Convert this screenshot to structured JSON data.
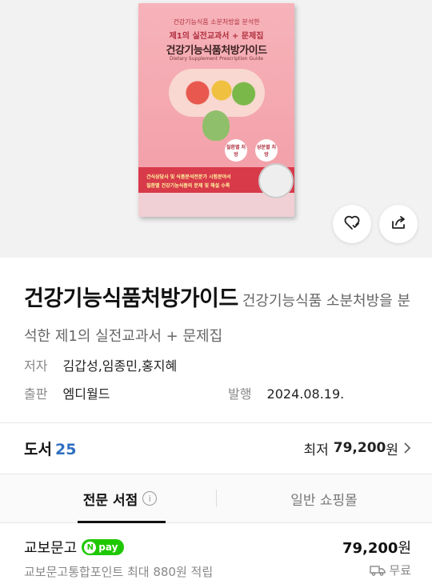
{
  "cover": {
    "line1": "건강기능식품 소분처방을 분석한",
    "line2": "제1의 실전교과서 + 문제집",
    "title": "건강기능식품처방가이드",
    "english": "Dietary Supplement Prescription Guide",
    "badge1": "질환별 처방",
    "badge2": "성분별 처방",
    "band1": "건식상담사 및 식품분석전문가 시험분야서",
    "band2": "질환별 건강기능식품의 문제 및 해설 수록"
  },
  "actions": {
    "wishlist_icon": "heart-check-icon",
    "share_icon": "share-icon"
  },
  "product": {
    "title": "건강기능식품처방가이드",
    "subtitle": "건강기능식품 소분처방을 분석한 제1의 실전교과서 + 문제집",
    "author_label": "저자",
    "author_value": "김갑성,임종민,홍지혜",
    "publisher_label": "출판",
    "publisher_value": "엠디월드",
    "date_label": "발행",
    "date_value": "2024.08.19."
  },
  "books": {
    "label": "도서",
    "count": "25",
    "lowest_label": "최저",
    "lowest_price": "79,200",
    "currency": "원"
  },
  "tabs": [
    {
      "label": "전문 서점",
      "active": true
    },
    {
      "label": "일반 쇼핑몰",
      "active": false
    }
  ],
  "store": {
    "name": "교보문고",
    "pay_badge": "pay",
    "pay_n": "N",
    "price": "79,200",
    "currency": "원",
    "points": "교보문고통합포인트 최대 880원 적립",
    "shipping": "무료"
  },
  "colors": {
    "accent_count": "#2f6fc0",
    "npay_green": "#1ec800"
  }
}
